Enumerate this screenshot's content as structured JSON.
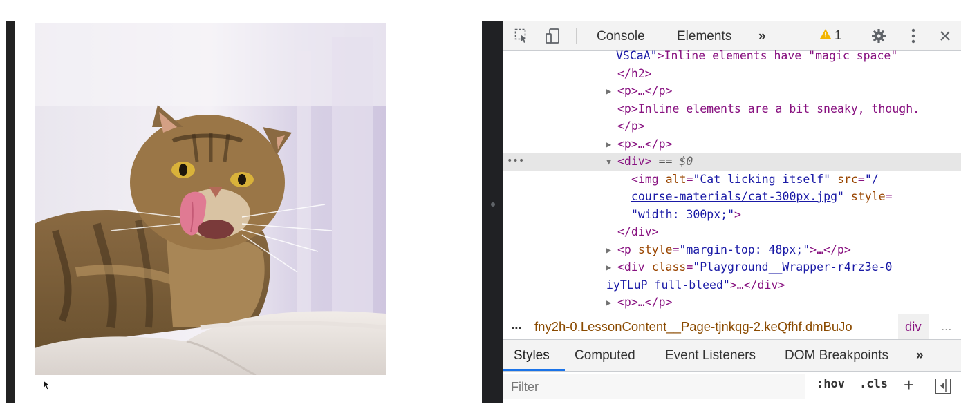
{
  "preview": {
    "image_alt": "Cat licking itself"
  },
  "devtools": {
    "toolbar": {
      "tabs": [
        "Console",
        "Elements"
      ],
      "more_tabs": "»",
      "warning_count": "1",
      "icons": [
        "inspect-element-icon",
        "device-toolbar-icon",
        "warning-icon",
        "settings-gear-icon",
        "kebab-menu-icon",
        "close-icon"
      ]
    },
    "dom_lines": {
      "l0_attr_tail": "VSCaA\"",
      "l0_text": ">Inline elements have \"magic space\"",
      "l1": "</h2>",
      "l2": "<p>…</p>",
      "l3": "<p>Inline elements are a bit sneaky, though.",
      "l4": "</p>",
      "l5": "<p>…</p>",
      "l6_tag": "<div>",
      "l6_eq": "==",
      "l6_ref": "$0",
      "gutter_dots": "•••",
      "l7_tag": "<img",
      "l7_alt_name": "alt",
      "l7_alt_val": "\"Cat licking itself\"",
      "l7_src_name": "src",
      "l7_src_val_start": "\"",
      "l7_src_link_a": "/",
      "l8_src_link": "course-materials/cat-300px.jpg",
      "l8_src_val_end": "\"",
      "l8_style_name": "style",
      "l9_style_val": "\"width: 300px;\"",
      "l9_close": ">",
      "l10": "</div>",
      "l11_tag": "<p",
      "l11_attr": "style",
      "l11_val": "\"margin-top: 48px;\"",
      "l11_rest": ">…</p>",
      "l12_tag": "<div",
      "l12_attr": "class",
      "l12_val": "\"Playground__Wrapper-r4rz3e-0",
      "l13_val": "iyTLuP full-bleed\"",
      "l13_rest": ">…</div>",
      "l14": "<p>…</p>"
    },
    "breadcrumb": {
      "dots": "...",
      "path": "fny2h-0.LessonContent__Page-tjnkqg-2.keQfhf.dmBuJo",
      "current": "div",
      "more": "..."
    },
    "panel_tabs": [
      "Styles",
      "Computed",
      "Event Listeners",
      "DOM Breakpoints"
    ],
    "panel_more": "»",
    "filter": {
      "placeholder": "Filter",
      "hov": ":hov",
      "cls": ".cls",
      "plus": "+"
    }
  }
}
